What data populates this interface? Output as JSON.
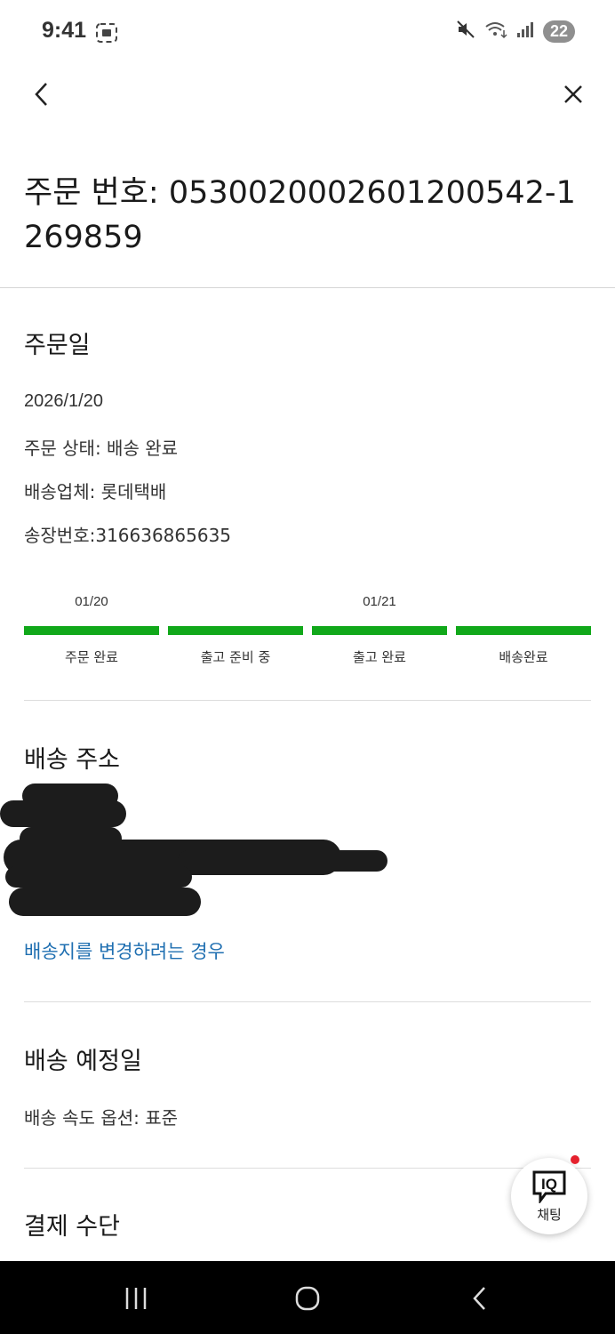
{
  "status_bar": {
    "time": "9:41",
    "battery": "22"
  },
  "header": {
    "order_title": "주문 번호: 0530020002601200542-1269859"
  },
  "order_date_section": {
    "title": "주문일",
    "date": "2026/1/20",
    "status": "주문 상태: 배송 완료",
    "carrier": "배송업체: 롯데택배",
    "tracking": "송장번호:316636865635"
  },
  "progress_steps": [
    {
      "date": "01/20",
      "label": "주문 완료"
    },
    {
      "date": "",
      "label": "출고 준비 중"
    },
    {
      "date": "01/21",
      "label": "출고 완료"
    },
    {
      "date": "",
      "label": "배송완료"
    }
  ],
  "progress_color": "#11a81a",
  "shipping_address_section": {
    "title": "배송 주소",
    "change_link": "배송지를 변경하려는 경우"
  },
  "delivery_section": {
    "title": "배송 예정일",
    "speed_option": "배송 속도 옵션: 표준"
  },
  "payment_section": {
    "title": "결제 수단"
  },
  "chat_button": {
    "logo": "IQ",
    "label": "채팅"
  },
  "colors": {
    "link": "#1f6fb1",
    "accent_green": "#11a81a",
    "notification": "#e5212d"
  }
}
